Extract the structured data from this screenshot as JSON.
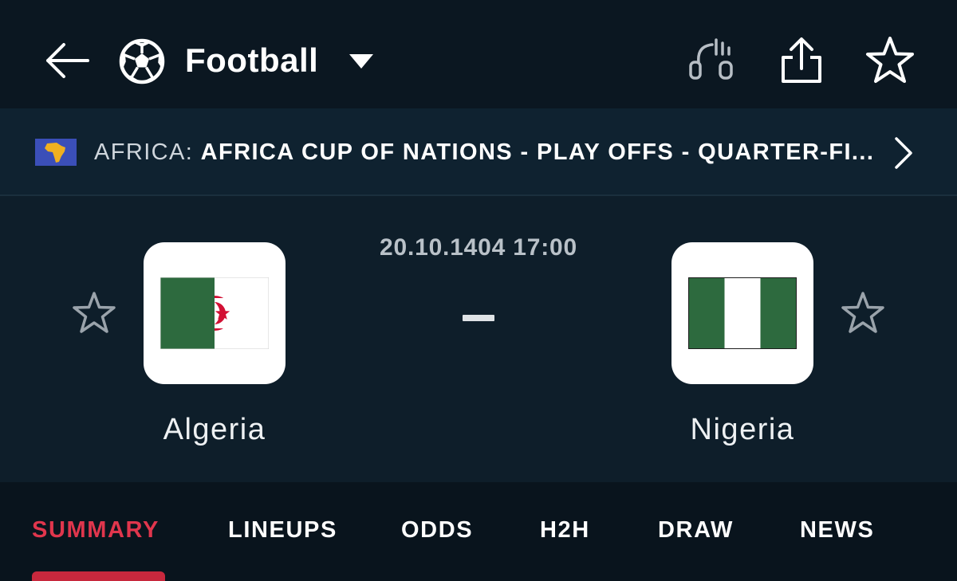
{
  "header": {
    "sport_label": "Football",
    "icons": {
      "back": "arrow-left-icon",
      "sport": "soccer-ball-icon",
      "dropdown": "caret-down-icon",
      "audio": "audio-commentary-icon",
      "share": "share-icon",
      "favorite": "star-outline-icon"
    }
  },
  "league": {
    "country": "AFRICA:",
    "name": "AFRICA CUP OF NATIONS - PLAY OFFS - QUARTER-FI...",
    "flag_icon": "africa-flag-icon",
    "chevron_icon": "chevron-right-icon"
  },
  "match": {
    "datetime": "20.10.1404 17:00",
    "score_separator": "–",
    "home": {
      "name": "Algeria",
      "flag_icon": "algeria-flag-icon",
      "favorite_icon": "star-outline-icon"
    },
    "away": {
      "name": "Nigeria",
      "flag_icon": "nigeria-flag-icon",
      "favorite_icon": "star-outline-icon"
    }
  },
  "tabs": {
    "active": "SUMMARY",
    "items": [
      {
        "label": "SUMMARY"
      },
      {
        "label": "LINEUPS"
      },
      {
        "label": "ODDS"
      },
      {
        "label": "H2H"
      },
      {
        "label": "DRAW"
      },
      {
        "label": "NEWS"
      }
    ]
  },
  "colors": {
    "background": "#0e1e2a",
    "topbar": "#0b1721",
    "league_bar": "#0f2230",
    "tabs_bar": "#09141d",
    "accent": "#e0364d",
    "algeria_green": "#2d6a3e",
    "algeria_red": "#d21034",
    "nigeria_green": "#2d6a3e"
  }
}
